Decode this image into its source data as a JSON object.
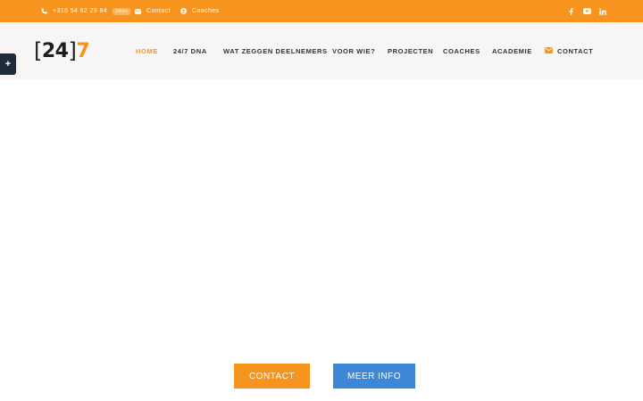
{
  "topbar": {
    "phone": "+316 54 62 29 84",
    "phone_badge": "24hrs",
    "contact": "Contact",
    "coaches": "Coaches"
  },
  "logo": {
    "bracket_open": "[",
    "number": "24",
    "bracket_close": "]",
    "accent": "7"
  },
  "nav": {
    "items": [
      {
        "label": "HOME",
        "active": true
      },
      {
        "label": "24/7 DNA"
      },
      {
        "label": "WAT ZEGGEN DEELNEMERS"
      },
      {
        "label": "VOOR WIE?"
      },
      {
        "label": "PROJECTEN"
      },
      {
        "label": "COACHES"
      },
      {
        "label": "ACADEMIE"
      },
      {
        "label": "CONTACT",
        "icon": "envelope-icon"
      }
    ]
  },
  "side_toggle": {
    "label": "+"
  },
  "hero": {
    "contact_button": "CONTACT",
    "info_button": "MEER INFO"
  },
  "colors": {
    "brand_orange": "#f7941d",
    "button_blue": "#3d87d6",
    "dark": "#1f2b3a"
  }
}
